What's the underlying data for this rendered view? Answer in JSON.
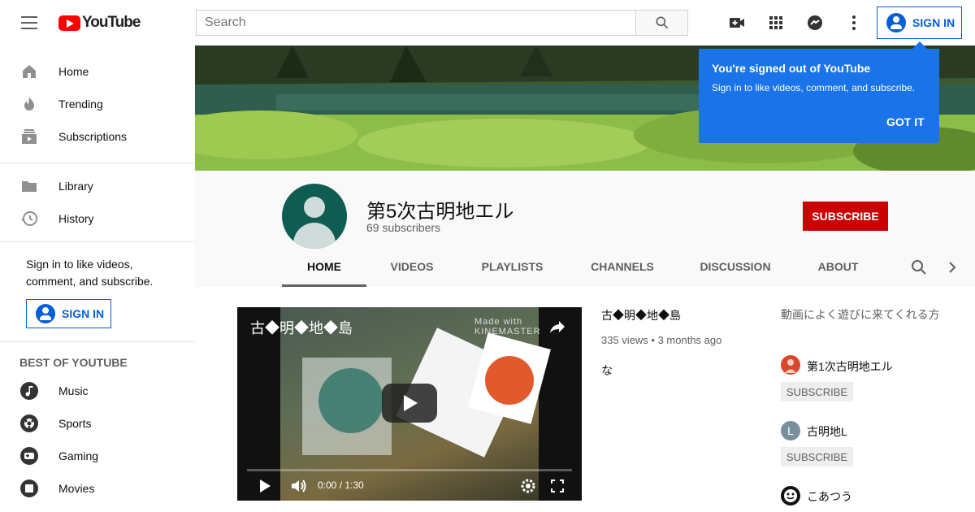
{
  "header": {
    "logo_text": "YouTube",
    "search_placeholder": "Search",
    "signin_label": "SIGN IN"
  },
  "sidebar": {
    "main": [
      {
        "label": "Home",
        "icon": "home-icon"
      },
      {
        "label": "Trending",
        "icon": "trending-icon"
      },
      {
        "label": "Subscriptions",
        "icon": "subscriptions-icon"
      }
    ],
    "library": [
      {
        "label": "Library",
        "icon": "library-icon"
      },
      {
        "label": "History",
        "icon": "history-icon"
      }
    ],
    "signin_prompt": "Sign in to like videos, comment, and subscribe.",
    "signin_label": "SIGN IN",
    "best_heading": "BEST OF YOUTUBE",
    "best": [
      {
        "label": "Music",
        "icon": "music-icon"
      },
      {
        "label": "Sports",
        "icon": "sports-icon"
      },
      {
        "label": "Gaming",
        "icon": "gaming-icon"
      },
      {
        "label": "Movies",
        "icon": "movies-icon"
      }
    ]
  },
  "tooltip": {
    "title": "You're signed out of YouTube",
    "body": "Sign in to like videos, comment, and subscribe.",
    "action": "GOT IT"
  },
  "channel": {
    "name": "第5次古明地エル",
    "subscribers": "69 subscribers",
    "subscribe_label": "SUBSCRIBE",
    "tabs": [
      "HOME",
      "VIDEOS",
      "PLAYLISTS",
      "CHANNELS",
      "DISCUSSION",
      "ABOUT"
    ],
    "active_tab": "HOME"
  },
  "featured_video": {
    "overlay_title": "古◆明◆地◆島",
    "watermark": "Made with KINEMASTER",
    "time": "0:00 / 1:30",
    "title": "古◆明◆地◆島",
    "meta": "335 views • 3 months ago",
    "description": "な"
  },
  "featured_channels": {
    "title": "動画によく遊びに来てくれる方",
    "items": [
      {
        "name": "第1次古明地エル",
        "subscribe": "SUBSCRIBE",
        "avatar_color": "#d9482b"
      },
      {
        "name": "古明地L",
        "subscribe": "SUBSCRIBE",
        "avatar_color": "#78909c",
        "initial": "L"
      },
      {
        "name": "こあつう",
        "avatar_color": "#111111"
      }
    ]
  },
  "colors": {
    "brand_red": "#ff0000",
    "subscribe_red": "#cc0000",
    "link_blue": "#065fd4",
    "tooltip_blue": "#1a73e8"
  }
}
